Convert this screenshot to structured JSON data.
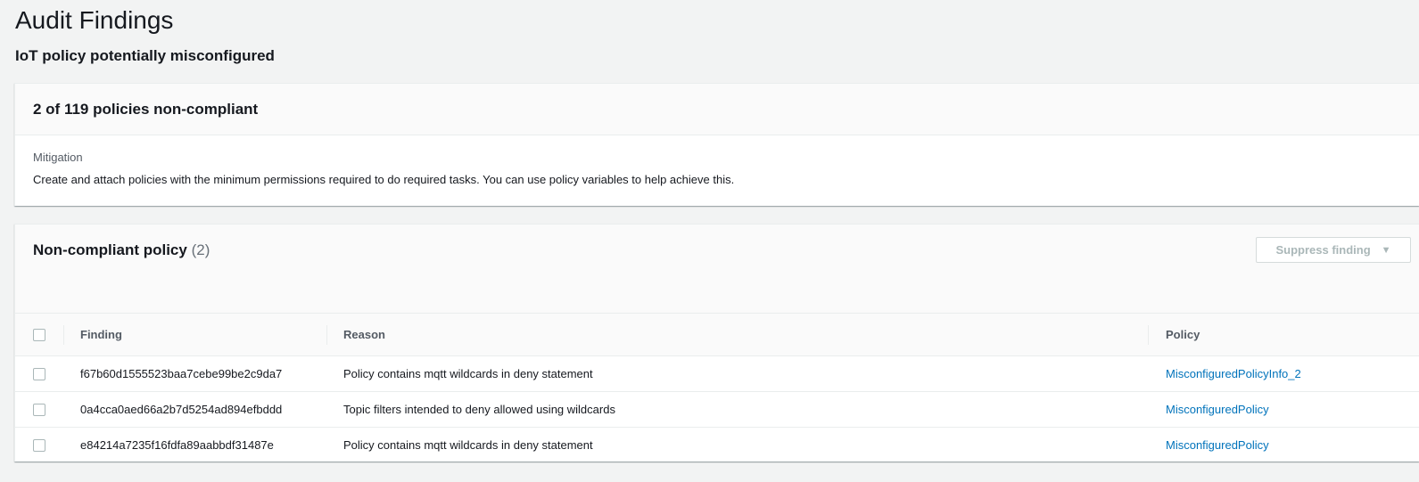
{
  "page": {
    "title": "Audit Findings",
    "subtitle": "IoT policy potentially misconfigured"
  },
  "summary": {
    "title": "2 of 119 policies non-compliant",
    "mitigation_label": "Mitigation",
    "mitigation_text": "Create and attach policies with the minimum permissions required to do required tasks. You can use policy variables to help achieve this."
  },
  "table": {
    "title": "Non-compliant policy",
    "count": "(2)",
    "suppress_button_label": "Suppress finding",
    "columns": {
      "finding": "Finding",
      "reason": "Reason",
      "policy": "Policy"
    },
    "rows": [
      {
        "finding": "f67b60d1555523baa7cebe99be2c9da7",
        "reason": "Policy contains mqtt wildcards in deny statement",
        "policy": "MisconfiguredPolicyInfo_2"
      },
      {
        "finding": "0a4cca0aed66a2b7d5254ad894efbddd",
        "reason": "Topic filters intended to deny allowed using wildcards",
        "policy": "MisconfiguredPolicy"
      },
      {
        "finding": "e84214a7235f16fdfa89aabbdf31487e",
        "reason": "Policy contains mqtt wildcards in deny statement",
        "policy": "MisconfiguredPolicy"
      }
    ]
  },
  "colors": {
    "link": "#0073bb",
    "disabled_text": "#aab7b8",
    "page_background": "#f2f3f3"
  },
  "icons": {
    "suppress_caret": "caret-down-icon"
  }
}
